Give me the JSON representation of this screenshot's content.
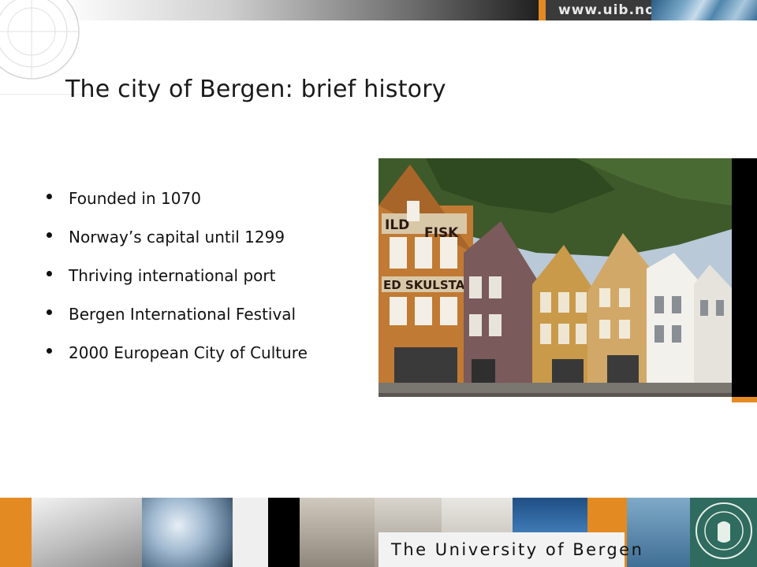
{
  "header": {
    "url_text": "www.uib.no"
  },
  "slide": {
    "title": "The city of Bergen: brief history",
    "bullets": [
      "Founded in 1070",
      "Norway’s capital until 1299",
      "Thriving international port",
      "Bergen International Festival",
      "2000 European City of Culture"
    ],
    "photo": {
      "signs": [
        "ILD",
        "FISK",
        "ED SKULSTAD"
      ]
    }
  },
  "footer": {
    "university_name": "The University of Bergen"
  },
  "colors": {
    "accent_orange": "#e38a22",
    "text": "#111111",
    "water_blue": "#4f86ad"
  },
  "icons": {
    "seal": "university-seal-icon",
    "watermark": "compass-watermark-icon"
  }
}
